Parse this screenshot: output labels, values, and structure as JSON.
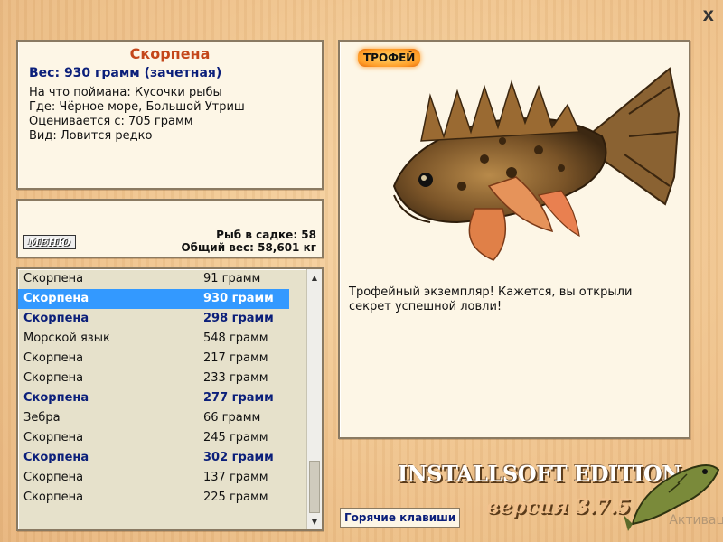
{
  "info": {
    "title": "Скорпена",
    "weight": "Вес: 930 грамм (зачетная)",
    "caught_on": "На что поймана: Кусочки рыбы",
    "location": "Где: Чёрное море, Большой Утриш",
    "valued": "Оценивается с: 705 грамм",
    "species": "Вид: Ловится редко"
  },
  "stats": {
    "menu_label": "МЕНЮ",
    "fish_count": "Рыб в садке: 58",
    "total_weight": "Общий вес: 58,601 кг"
  },
  "catch_list": [
    {
      "name": "Скорпена",
      "weight": "91 грамм",
      "style": "normal"
    },
    {
      "name": "Скорпена",
      "weight": "930 грамм",
      "style": "selected"
    },
    {
      "name": "Скорпена",
      "weight": "298 грамм",
      "style": "bold"
    },
    {
      "name": "Морской язык",
      "weight": "548 грамм",
      "style": "normal"
    },
    {
      "name": "Скорпена",
      "weight": "217 грамм",
      "style": "normal"
    },
    {
      "name": "Скорпена",
      "weight": "233 грамм",
      "style": "normal"
    },
    {
      "name": "Скорпена",
      "weight": "277 грамм",
      "style": "bold"
    },
    {
      "name": "Зебра",
      "weight": "66 грамм",
      "style": "normal"
    },
    {
      "name": "Скорпена",
      "weight": "245 грамм",
      "style": "normal"
    },
    {
      "name": "Скорпена",
      "weight": "302 грамм",
      "style": "bold"
    },
    {
      "name": "Скорпена",
      "weight": "137 грамм",
      "style": "normal"
    },
    {
      "name": "Скорпена",
      "weight": "225 грамм",
      "style": "normal"
    }
  ],
  "detail": {
    "badge": "ТРОФЕЙ",
    "description": "Трофейный экземпляр! Кажется, вы открыли секрет успешной ловли!"
  },
  "brand": {
    "name": "INSTALLSOFT EDITION",
    "version": "версия 3.7.5"
  },
  "hotkeys_label": "Горячие клавиши",
  "close_label": "X",
  "activate_text": "Активац"
}
